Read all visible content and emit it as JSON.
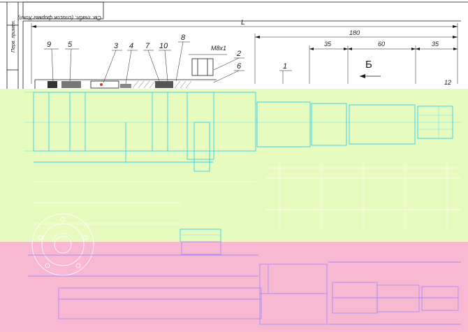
{
  "stamp": {
    "title_block": "См. табл. (список фирмы Хоял)",
    "side_label": "Перв. примен."
  },
  "dimensions": {
    "overall": "L",
    "length_180": "180",
    "seg_35_left": "35",
    "seg_60": "60",
    "seg_35_right": "35",
    "thread": "M8x1",
    "small_12": "12"
  },
  "view_label": "Б",
  "callouts": [
    "9",
    "5",
    "3",
    "4",
    "7",
    "10",
    "8",
    "2",
    "6",
    "1"
  ],
  "colors": {
    "band_green": "#e8fbbf",
    "band_pink": "#f8b8d2",
    "line_cyan": "#2ad1f0",
    "line_violet": "#a58df3"
  }
}
